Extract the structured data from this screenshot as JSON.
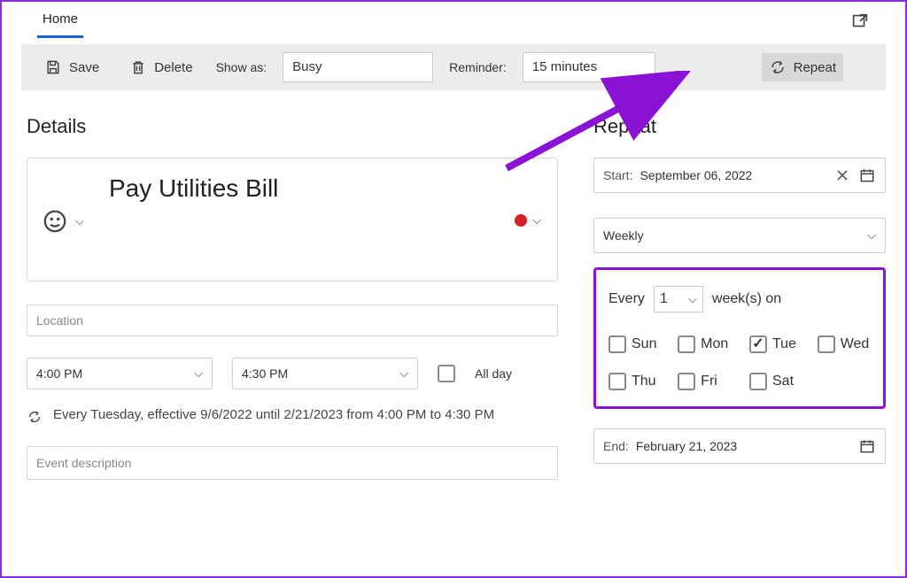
{
  "tabs": {
    "home": "Home"
  },
  "toolbar": {
    "save": "Save",
    "delete": "Delete",
    "show_as_label": "Show as:",
    "show_as_value": "Busy",
    "reminder_label": "Reminder:",
    "reminder_value": "15 minutes",
    "repeat": "Repeat"
  },
  "details": {
    "heading": "Details",
    "title": "Pay Utilities Bill",
    "location_placeholder": "Location",
    "start_time": "4:00 PM",
    "end_time": "4:30 PM",
    "all_day": "All day",
    "recurrence_text": "Every Tuesday, effective 9/6/2022 until 2/21/2023 from 4:00 PM to 4:30 PM",
    "description_placeholder": "Event description"
  },
  "repeat": {
    "heading": "Repeat",
    "start_label": "Start:",
    "start_value": "September 06, 2022",
    "frequency": "Weekly",
    "every_label": "Every",
    "every_value": "1",
    "every_unit": "week(s) on",
    "days": [
      {
        "label": "Sun",
        "checked": false
      },
      {
        "label": "Mon",
        "checked": false
      },
      {
        "label": "Tue",
        "checked": true
      },
      {
        "label": "Wed",
        "checked": false
      },
      {
        "label": "Thu",
        "checked": false
      },
      {
        "label": "Fri",
        "checked": false
      },
      {
        "label": "Sat",
        "checked": false
      }
    ],
    "end_label": "End:",
    "end_value": "February 21, 2023"
  }
}
